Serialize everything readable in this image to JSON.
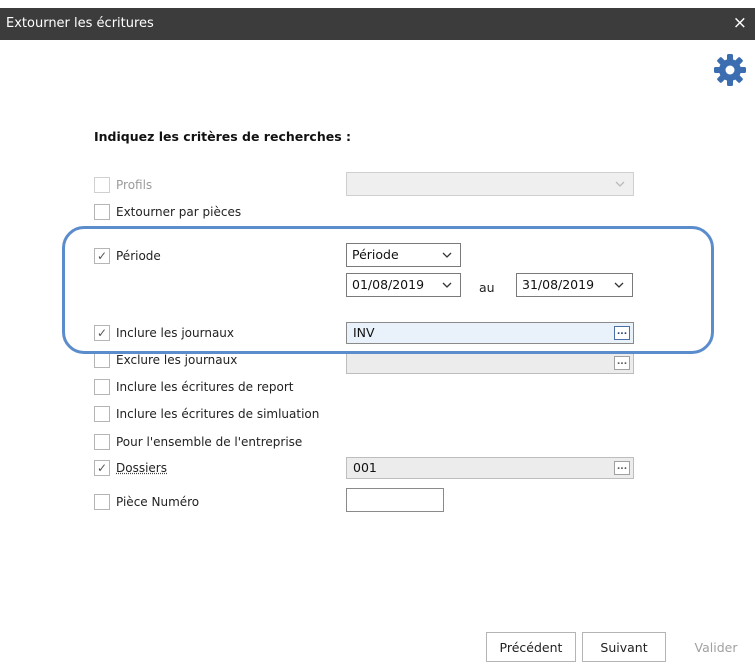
{
  "window": {
    "title": "Extourner les écritures",
    "close_label": "×"
  },
  "heading": "Indiquez les critères de recherches :",
  "options": {
    "profils": {
      "label": "Profils",
      "checked": false
    },
    "par_pieces": {
      "label": "Extourner par pièces",
      "checked": false
    },
    "periode": {
      "label": "Période",
      "checked": true
    },
    "inclure_journaux": {
      "label": "Inclure les journaux",
      "checked": true
    },
    "exclure_journaux": {
      "label": "Exclure les journaux",
      "checked": false
    },
    "ecritures_report": {
      "label": "Inclure les écritures de report",
      "checked": false
    },
    "ecritures_simulation": {
      "label": "Inclure les écritures de simluation",
      "checked": false
    },
    "ensemble_entreprise": {
      "label": "Pour l'ensemble de l'entreprise",
      "checked": false
    },
    "dossiers": {
      "label": "Dossiers",
      "checked": true
    },
    "piece_numero": {
      "label": "Pièce Numéro",
      "checked": false
    }
  },
  "check_glyph": "✓",
  "fields": {
    "profils_value": "",
    "periode_type": "Période",
    "date_from": "01/08/2019",
    "date_sep": "au",
    "date_to": "31/08/2019",
    "journaux_value": "INV",
    "exclure_value": "",
    "dossiers_value": "001",
    "piece_value": "",
    "ellipsis": "..."
  },
  "buttons": {
    "prev": "Précédent",
    "next": "Suivant",
    "validate": "Valider"
  },
  "colors": {
    "titlebar": "#3c3c3c",
    "accent": "#3b6db0",
    "highlight": "#5b8ccc"
  }
}
